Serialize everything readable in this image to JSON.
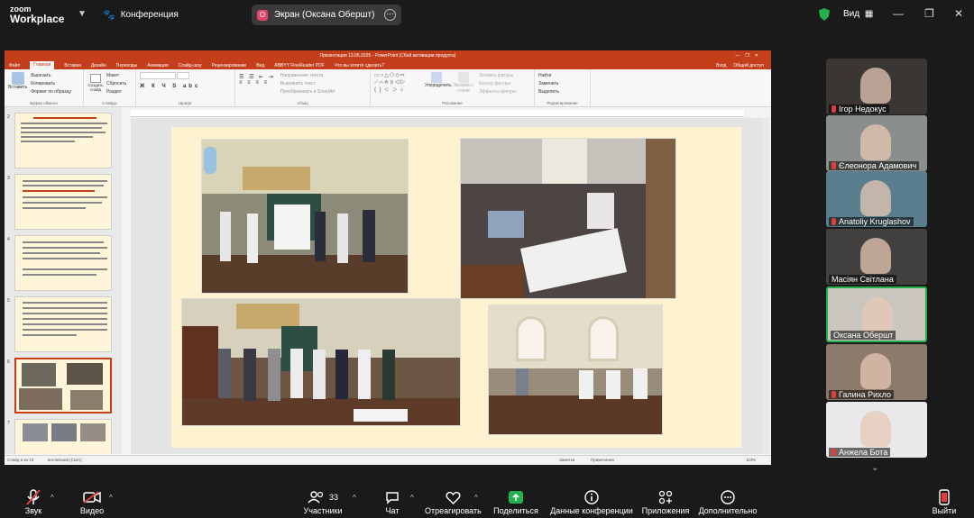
{
  "app": {
    "logo_top": "zoom",
    "logo_bottom": "Workplace",
    "meeting_name": "Конференция"
  },
  "share": {
    "initial": "О",
    "label": "Экран (Оксана Обершт)"
  },
  "top_right": {
    "view_label": "Вид"
  },
  "colors": {
    "accent_green": "#23b14d",
    "ppt_red": "#c43e1c",
    "mute_red": "#e23d3d",
    "bg": "#1a1a1a"
  },
  "ppt": {
    "window_title": "Презентация 13.05.2025 - PowerPoint (Сбой активации продукта)",
    "tabs": [
      "Файл",
      "Главная",
      "Вставка",
      "Дизайн",
      "Переходы",
      "Анимация",
      "Слайд-шоу",
      "Рецензирование",
      "Вид",
      "ABBYY FineReader PDF",
      "Что вы хотите сделать?"
    ],
    "active_tab": "Главная",
    "top_right": [
      "Вход",
      "Общий доступ"
    ],
    "ribbon": {
      "paste": "Вставить",
      "clipboard": [
        "Вырезать",
        "Копировать",
        "Формат по образцу"
      ],
      "clipboard_group": "Буфер обмена",
      "new_slide": "Создать слайд",
      "slides": [
        "Макет",
        "Сбросить",
        "Раздел"
      ],
      "slides_group": "Слайды",
      "font_group": "Шрифт",
      "paragraph": [
        "Направление текста",
        "Выровнять текст",
        "Преобразовать в SmartArt"
      ],
      "paragraph_group": "Абзац",
      "arrange": "Упорядочить",
      "quick_styles": "Экспресс-стили",
      "shape_format": [
        "Заливка фигуры",
        "Контур фигуры",
        "Эффекты фигуры"
      ],
      "drawing_group": "Рисование",
      "editing": [
        "Найти",
        "Заменить",
        "Выделить"
      ],
      "editing_group": "Редактирование"
    },
    "thumbnail_numbers": [
      "2",
      "3",
      "4",
      "5",
      "6",
      "7"
    ],
    "selected_slide": "6",
    "status": {
      "slide": "Слайд 6 из 15",
      "language": "английский (США)",
      "notes": "Заметки",
      "comments": "Примечания",
      "zoom": "113%"
    }
  },
  "participants": [
    {
      "name": "Ігор Недокус",
      "muted": true
    },
    {
      "name": "Єлеонора Адамович",
      "muted": true
    },
    {
      "name": "Anatoliy Kruglashov",
      "muted": true
    },
    {
      "name": "Масіян Світлана",
      "muted": false
    },
    {
      "name": "Оксана Обершт",
      "muted": false
    },
    {
      "name": "Галина Рихло",
      "muted": true
    },
    {
      "name": "Анжела Бота",
      "muted": true
    }
  ],
  "toolbar": {
    "audio": "Звук",
    "video": "Видео",
    "participants": "Участники",
    "participants_count": "33",
    "chat": "Чат",
    "react": "Отреагировать",
    "share": "Поделиться",
    "info": "Данные конференции",
    "apps": "Приложения",
    "more": "Дополнительно",
    "leave": "Выйти"
  }
}
